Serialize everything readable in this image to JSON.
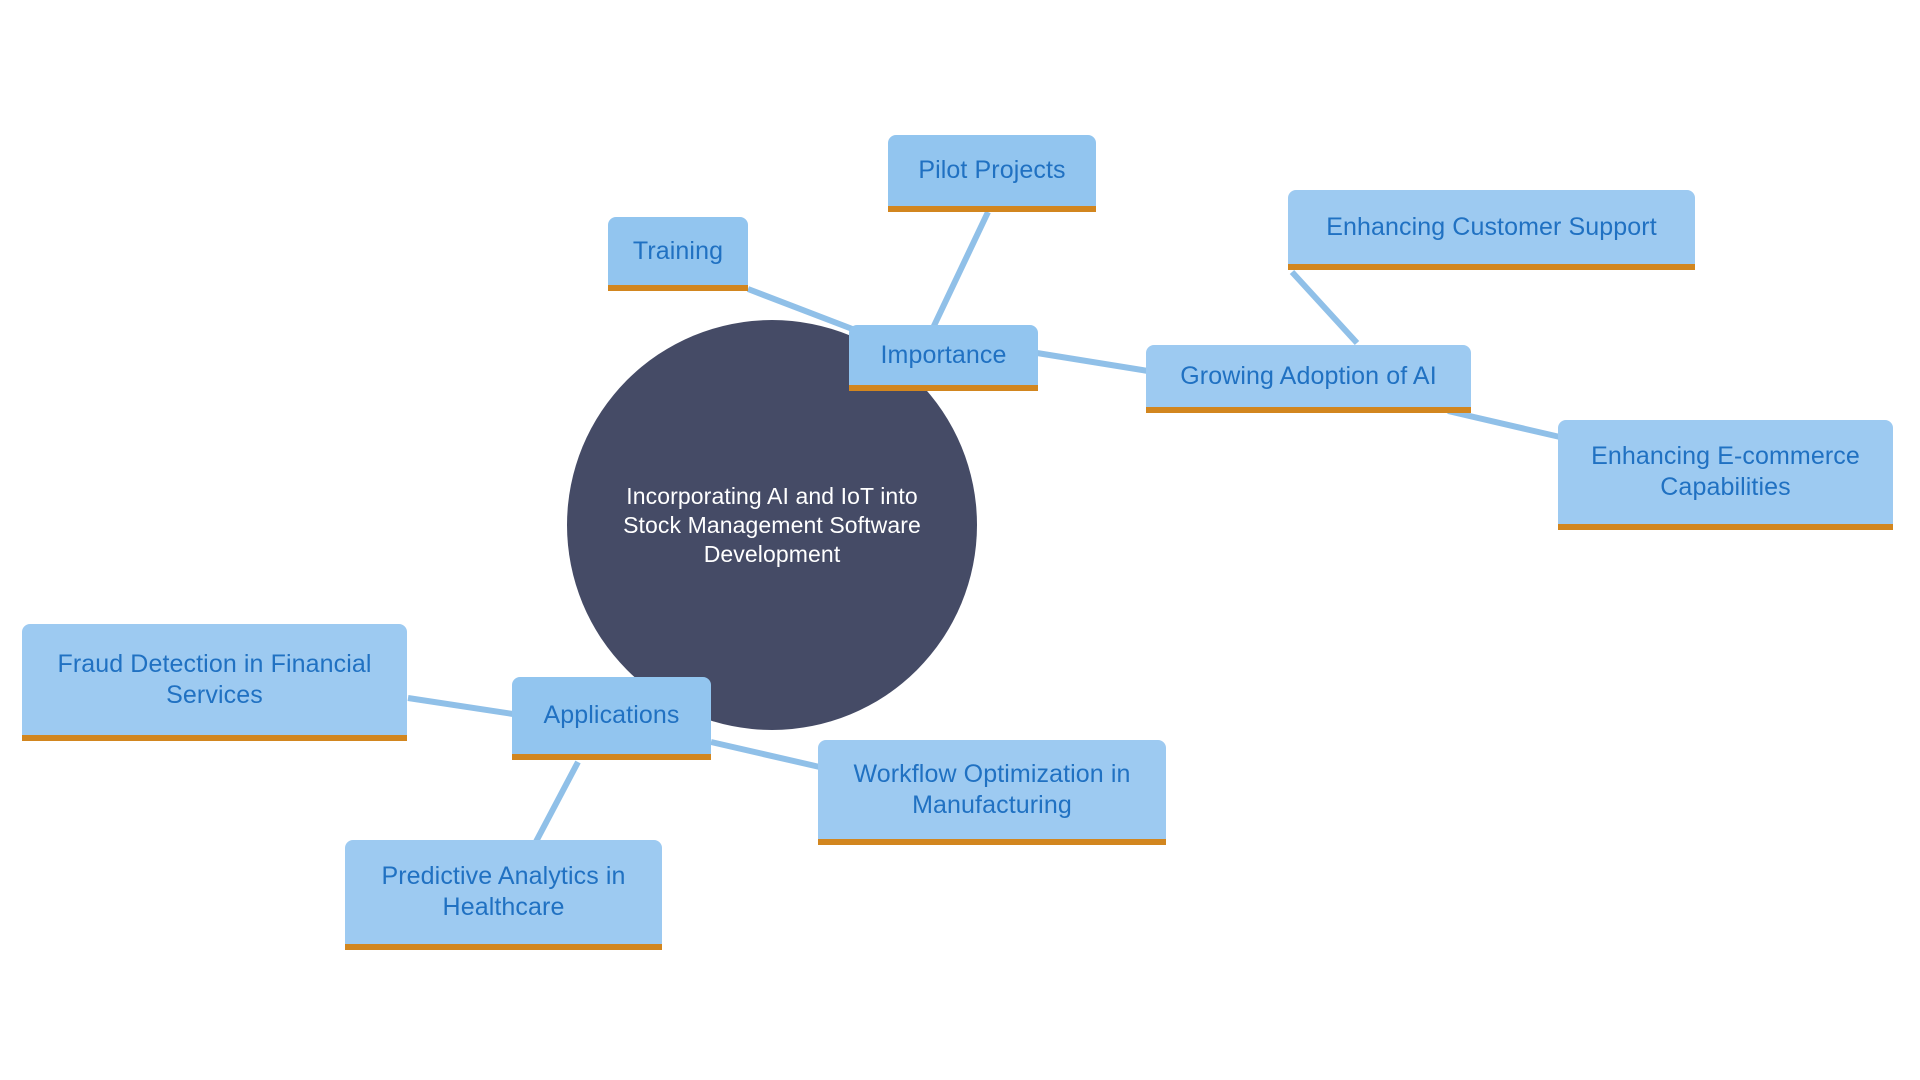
{
  "diagram": {
    "type": "mind-map",
    "background_color": "#ffffff",
    "palette": {
      "root_fill": "#454b66",
      "root_text": "#ffffff",
      "node_fill": "#92c5ef",
      "node_fill_alt": "#9dcaf1",
      "node_accent_border": "#d2861f",
      "node_text": "#2071c2",
      "edge_color": "#90c0e8"
    },
    "root": {
      "label": "Incorporating AI and IoT into Stock Management Software Development"
    },
    "branches": [
      {
        "label": "Importance",
        "children": [
          {
            "label": "Training",
            "children": []
          },
          {
            "label": "Pilot Projects",
            "children": []
          },
          {
            "label": "Growing Adoption of AI",
            "children": [
              {
                "label": "Enhancing Customer Support"
              },
              {
                "label": "Enhancing E-commerce Capabilities"
              }
            ]
          }
        ]
      },
      {
        "label": "Applications",
        "children": [
          {
            "label": "Fraud Detection in Financial Services",
            "children": []
          },
          {
            "label": "Predictive Analytics in Healthcare",
            "children": []
          },
          {
            "label": "Workflow Optimization in Manufacturing",
            "children": []
          }
        ]
      }
    ],
    "nodes": {
      "root": "Incorporating AI and IoT into Stock Management Software Development",
      "importance": "Importance",
      "training": "Training",
      "pilot_projects": "Pilot Projects",
      "growing_adoption": "Growing Adoption of AI",
      "customer_support": "Enhancing Customer Support",
      "ecommerce": "Enhancing E-commerce Capabilities",
      "applications": "Applications",
      "fraud_detection": "Fraud Detection in Financial Services",
      "predictive_analytics": "Predictive Analytics in Healthcare",
      "workflow_optimization": "Workflow Optimization in Manufacturing"
    },
    "edges": [
      {
        "from": "root",
        "to": "importance"
      },
      {
        "from": "importance",
        "to": "training"
      },
      {
        "from": "importance",
        "to": "pilot_projects"
      },
      {
        "from": "importance",
        "to": "growing_adoption"
      },
      {
        "from": "growing_adoption",
        "to": "customer_support"
      },
      {
        "from": "growing_adoption",
        "to": "ecommerce"
      },
      {
        "from": "root",
        "to": "applications"
      },
      {
        "from": "applications",
        "to": "fraud_detection"
      },
      {
        "from": "applications",
        "to": "predictive_analytics"
      },
      {
        "from": "applications",
        "to": "workflow_optimization"
      }
    ]
  }
}
